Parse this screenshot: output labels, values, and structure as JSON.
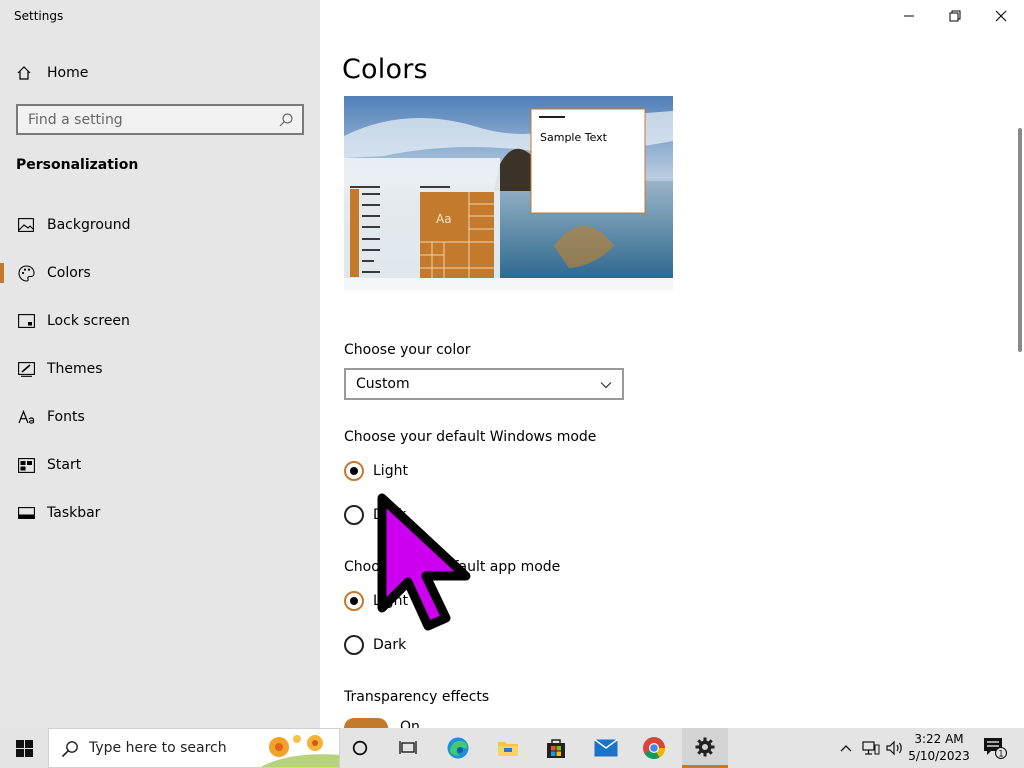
{
  "window": {
    "title": "Settings"
  },
  "sidebar": {
    "home_label": "Home",
    "search_placeholder": "Find a setting",
    "section_title": "Personalization",
    "items": [
      {
        "label": "Background",
        "icon": "picture-icon"
      },
      {
        "label": "Colors",
        "icon": "palette-icon",
        "active": true
      },
      {
        "label": "Lock screen",
        "icon": "lock-screen-icon"
      },
      {
        "label": "Themes",
        "icon": "themes-icon"
      },
      {
        "label": "Fonts",
        "icon": "fonts-icon"
      },
      {
        "label": "Start",
        "icon": "start-icon"
      },
      {
        "label": "Taskbar",
        "icon": "taskbar-icon"
      }
    ]
  },
  "main": {
    "title": "Colors",
    "preview": {
      "sample_text": "Sample Text",
      "tile_text": "Aa"
    },
    "choose_color": {
      "label": "Choose your color",
      "value": "Custom"
    },
    "windows_mode": {
      "label": "Choose your default Windows mode",
      "options": [
        "Light",
        "Dark"
      ],
      "selected": "Light"
    },
    "app_mode": {
      "label": "Choose your default app mode",
      "options": [
        "Light",
        "Dark"
      ],
      "selected": "Light"
    },
    "transparency": {
      "label": "Transparency effects",
      "value": "On"
    }
  },
  "taskbar": {
    "search_placeholder": "Type here to search",
    "time": "3:22 AM",
    "date": "5/10/2023",
    "notification_count": "1"
  },
  "colors": {
    "accent": "#c47a2c",
    "sidebar_bg": "#e6e6e6",
    "taskbar_bg": "#e4e4e4",
    "cursor": "#cc00ee"
  }
}
